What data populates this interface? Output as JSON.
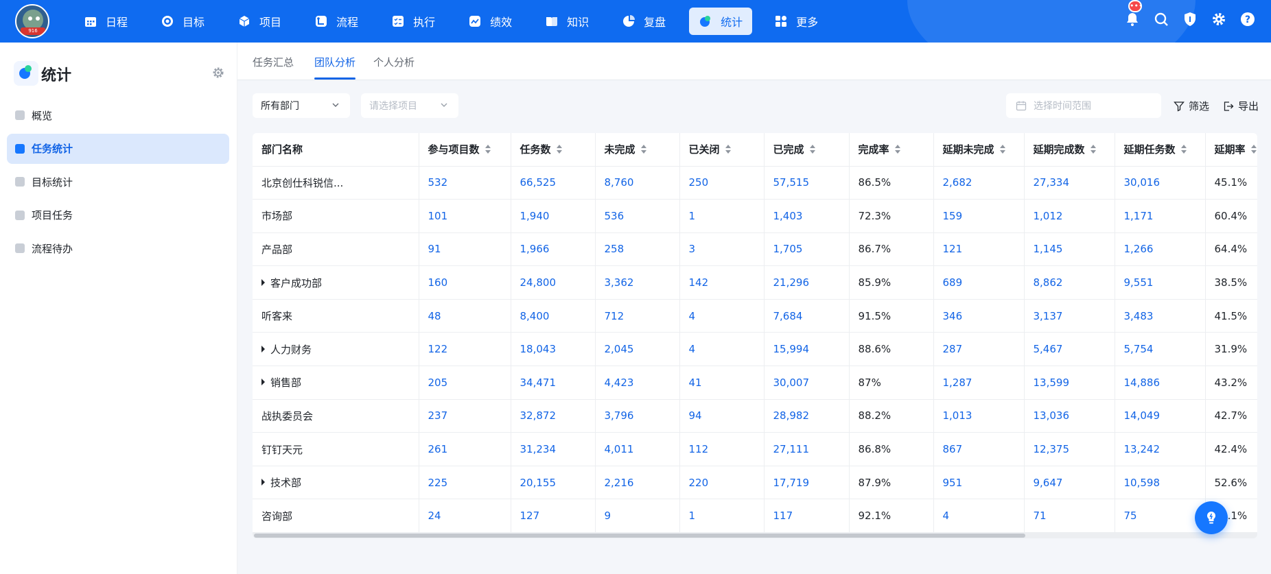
{
  "topnav": {
    "items": [
      {
        "label": "日程",
        "icon": "calendar-icon"
      },
      {
        "label": "目标",
        "icon": "target-icon"
      },
      {
        "label": "项目",
        "icon": "cube-icon"
      },
      {
        "label": "流程",
        "icon": "flow-icon"
      },
      {
        "label": "执行",
        "icon": "checklist-icon"
      },
      {
        "label": "绩效",
        "icon": "performance-icon"
      },
      {
        "label": "知识",
        "icon": "book-icon"
      },
      {
        "label": "复盘",
        "icon": "review-icon"
      },
      {
        "label": "统计",
        "icon": "stats-icon",
        "active": true
      },
      {
        "label": "更多",
        "icon": "grid-icon"
      }
    ],
    "notification_badge": "•••",
    "accent": "#0f6bf0"
  },
  "sidebar": {
    "title": "统计",
    "items": [
      {
        "label": "概览"
      },
      {
        "label": "任务统计",
        "active": true
      },
      {
        "label": "目标统计"
      },
      {
        "label": "项目任务"
      },
      {
        "label": "流程待办"
      }
    ]
  },
  "tabs": [
    {
      "label": "任务汇总"
    },
    {
      "label": "团队分析",
      "active": true
    },
    {
      "label": "个人分析"
    }
  ],
  "filters": {
    "department": "所有部门",
    "project_placeholder": "请选择项目",
    "date_placeholder": "选择时间范围",
    "filter_label": "筛选",
    "export_label": "导出"
  },
  "table": {
    "columns": [
      "部门名称",
      "参与项目数",
      "任务数",
      "未完成",
      "已关闭",
      "已完成",
      "完成率",
      "延期未完成",
      "延期完成数",
      "延期任务数",
      "延期率"
    ],
    "rows": [
      {
        "name": "北京创仕科锐信...",
        "expandable": false,
        "cells": [
          "532",
          "66,525",
          "8,760",
          "250",
          "57,515",
          "86.5%",
          "2,682",
          "27,334",
          "30,016",
          "45.1%"
        ]
      },
      {
        "name": "市场部",
        "expandable": false,
        "cells": [
          "101",
          "1,940",
          "536",
          "1",
          "1,403",
          "72.3%",
          "159",
          "1,012",
          "1,171",
          "60.4%"
        ]
      },
      {
        "name": "产品部",
        "expandable": false,
        "cells": [
          "91",
          "1,966",
          "258",
          "3",
          "1,705",
          "86.7%",
          "121",
          "1,145",
          "1,266",
          "64.4%"
        ]
      },
      {
        "name": "客户成功部",
        "expandable": true,
        "cells": [
          "160",
          "24,800",
          "3,362",
          "142",
          "21,296",
          "85.9%",
          "689",
          "8,862",
          "9,551",
          "38.5%"
        ]
      },
      {
        "name": "听客来",
        "expandable": false,
        "cells": [
          "48",
          "8,400",
          "712",
          "4",
          "7,684",
          "91.5%",
          "346",
          "3,137",
          "3,483",
          "41.5%"
        ]
      },
      {
        "name": "人力财务",
        "expandable": true,
        "cells": [
          "122",
          "18,043",
          "2,045",
          "4",
          "15,994",
          "88.6%",
          "287",
          "5,467",
          "5,754",
          "31.9%"
        ]
      },
      {
        "name": "销售部",
        "expandable": true,
        "cells": [
          "205",
          "34,471",
          "4,423",
          "41",
          "30,007",
          "87%",
          "1,287",
          "13,599",
          "14,886",
          "43.2%"
        ]
      },
      {
        "name": "战执委员会",
        "expandable": false,
        "cells": [
          "237",
          "32,872",
          "3,796",
          "94",
          "28,982",
          "88.2%",
          "1,013",
          "13,036",
          "14,049",
          "42.7%"
        ]
      },
      {
        "name": "钉钉天元",
        "expandable": false,
        "cells": [
          "261",
          "31,234",
          "4,011",
          "112",
          "27,111",
          "86.8%",
          "867",
          "12,375",
          "13,242",
          "42.4%"
        ]
      },
      {
        "name": "技术部",
        "expandable": true,
        "cells": [
          "225",
          "20,155",
          "2,216",
          "220",
          "17,719",
          "87.9%",
          "951",
          "9,647",
          "10,598",
          "52.6%"
        ]
      },
      {
        "name": "咨询部",
        "expandable": false,
        "cells": [
          "24",
          "127",
          "9",
          "1",
          "117",
          "92.1%",
          "4",
          "71",
          "75",
          "92.1%"
        ]
      }
    ]
  }
}
